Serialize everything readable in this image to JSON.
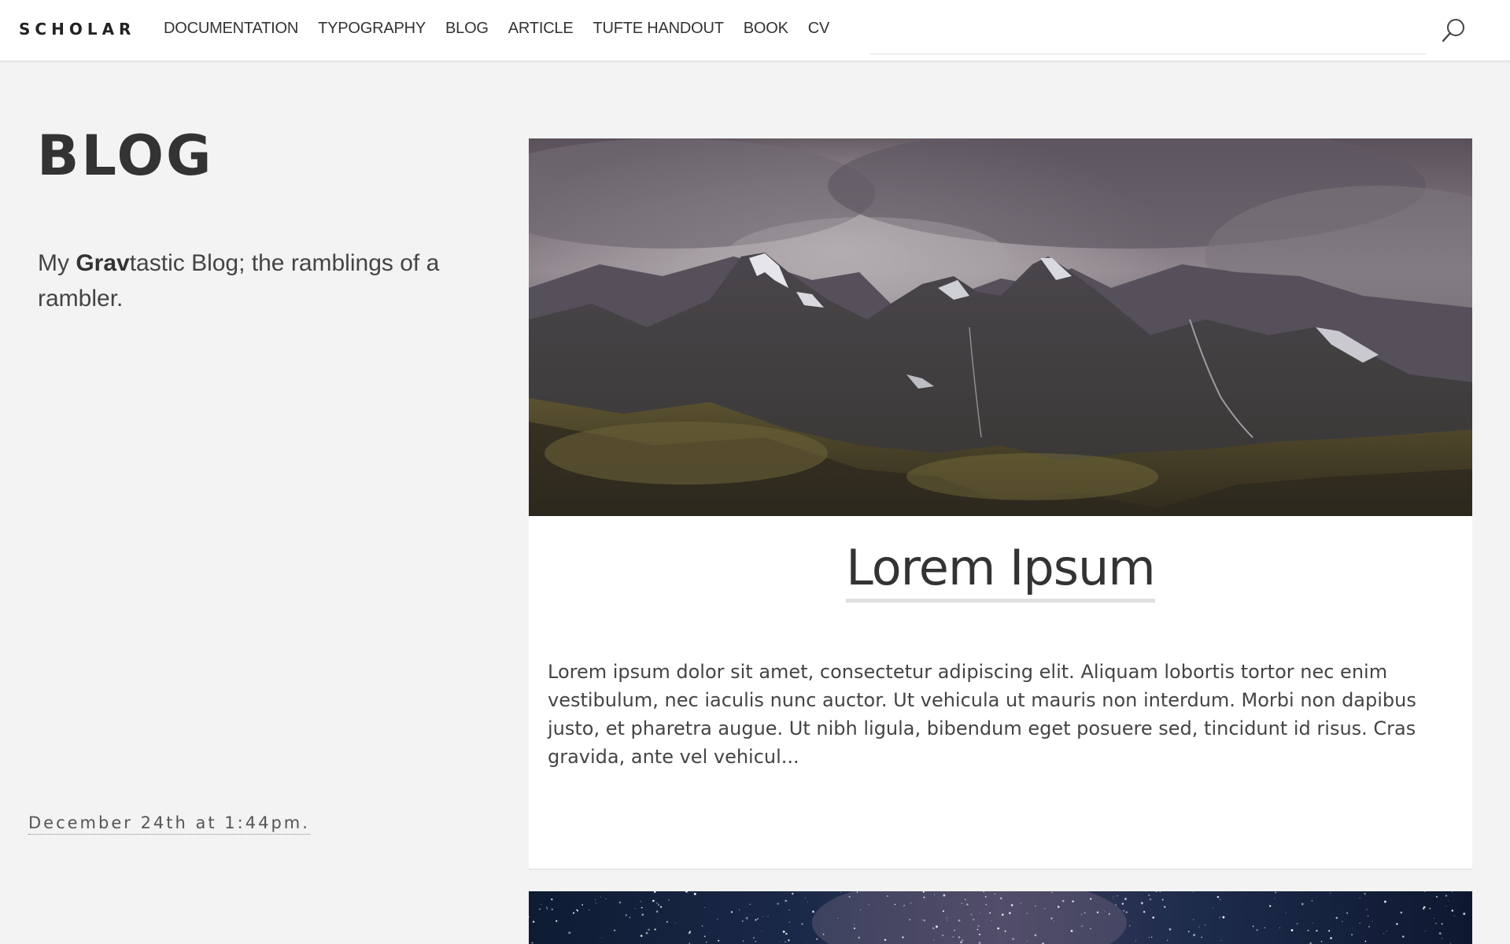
{
  "header": {
    "brand": "SCHOLAR",
    "nav": [
      {
        "label": "DOCUMENTATION"
      },
      {
        "label": "TYPOGRAPHY"
      },
      {
        "label": "BLOG"
      },
      {
        "label": "ARTICLE"
      },
      {
        "label": "TUFTE HANDOUT"
      },
      {
        "label": "BOOK"
      },
      {
        "label": "CV"
      }
    ],
    "search_icon": "search-icon"
  },
  "page": {
    "title": "BLOG",
    "intro_before": "My ",
    "intro_bold": "Grav",
    "intro_after": "tastic Blog; the ramblings of a rambler."
  },
  "posts": [
    {
      "title": "Lorem Ipsum",
      "excerpt": "Lorem ipsum dolor sit amet, consectetur adipiscing elit. Aliquam lobortis tortor nec enim vestibulum, nec iaculis nunc auctor. Ut vehicula ut mauris non interdum. Morbi non dapibus justo, et pharetra augue. Ut nibh ligula, bibendum eget posuere sed, tincidunt id risus. Cras gravida, ante vel vehicul...",
      "date": "December 24th at 1:44pm."
    }
  ],
  "colors": {
    "background": "#f3f3f3",
    "header_bg": "#ffffff",
    "card_bg": "#ffffff",
    "text": "#333333",
    "title_underline": "#e0e0e0"
  }
}
